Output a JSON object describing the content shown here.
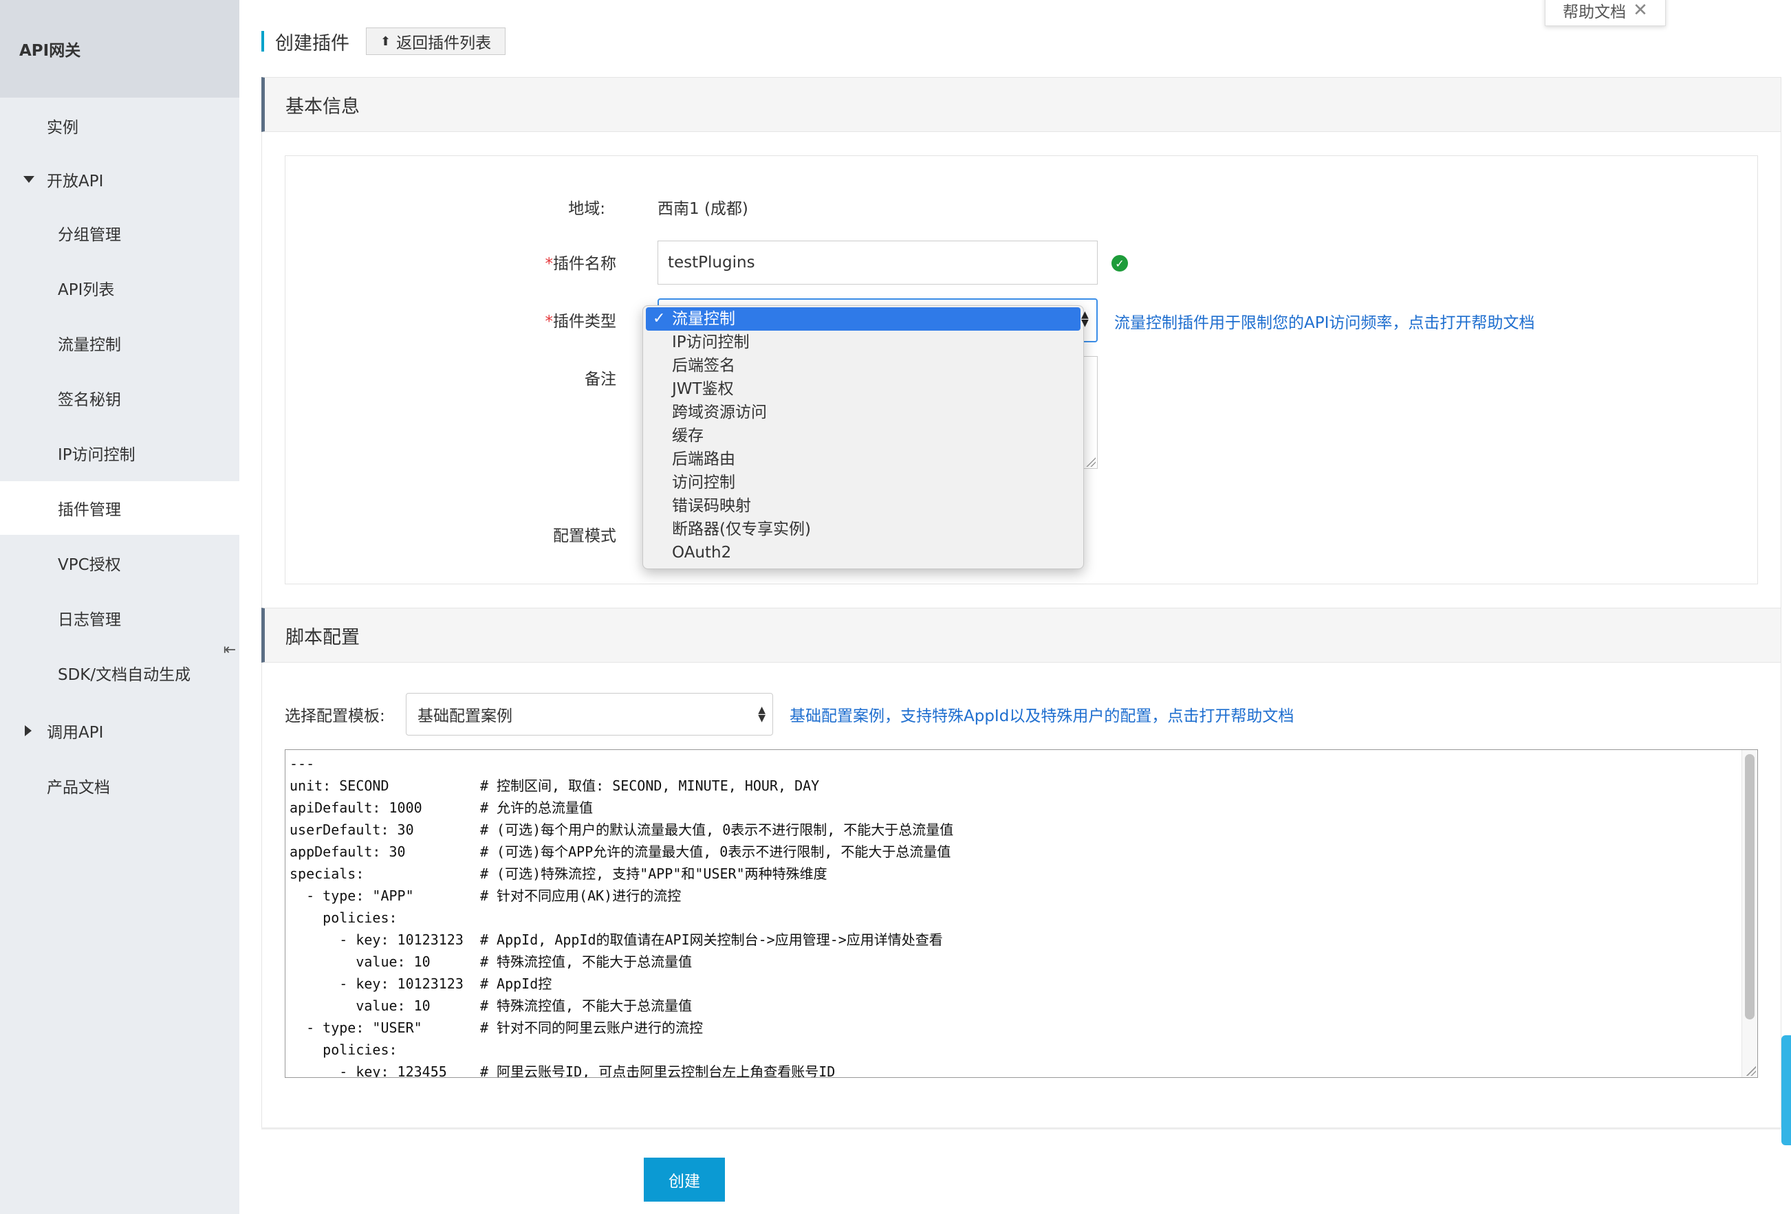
{
  "sidebar": {
    "title": "API网关",
    "items": [
      {
        "label": "实例"
      },
      {
        "label": "开放API"
      },
      {
        "label": "分组管理"
      },
      {
        "label": "API列表"
      },
      {
        "label": "流量控制"
      },
      {
        "label": "签名秘钥"
      },
      {
        "label": "IP访问控制"
      },
      {
        "label": "插件管理"
      },
      {
        "label": "VPC授权"
      },
      {
        "label": "日志管理"
      },
      {
        "label": "SDK/文档自动生成"
      },
      {
        "label": "调用API"
      },
      {
        "label": "产品文档"
      }
    ],
    "collapse_icon": "collapse-icon"
  },
  "header": {
    "title": "创建插件",
    "back_label": "返回插件列表",
    "help_label": "帮助文档"
  },
  "basic": {
    "section_title": "基本信息",
    "region_label": "地域:",
    "region_value": "西南1 (成都)",
    "name_label": "插件名称",
    "name_value": "testPlugins",
    "type_label": "插件类型",
    "type_hint": "流量控制插件用于限制您的API访问频率，点击打开帮助文档",
    "remark_label": "备注",
    "config_label": "配置模式",
    "required_mark": "*",
    "type_options": [
      "流量控制",
      "IP访问控制",
      "后端签名",
      "JWT鉴权",
      "跨域资源访问",
      "缓存",
      "后端路由",
      "访问控制",
      "错误码映射",
      "断路器(仅专享实例)",
      "OAuth2"
    ],
    "type_selected": "流量控制"
  },
  "script": {
    "section_title": "脚本配置",
    "template_label": "选择配置模板:",
    "template_value": "基础配置案例",
    "template_hint": "基础配置案例，支持特殊AppId以及特殊用户的配置，点击打开帮助文档",
    "code_lines": [
      "---",
      "unit: SECOND           # 控制区间, 取值: SECOND, MINUTE, HOUR, DAY",
      "apiDefault: 1000       # 允许的总流量值",
      "userDefault: 30        # (可选)每个用户的默认流量最大值, 0表示不进行限制, 不能大于总流量值",
      "appDefault: 30         # (可选)每个APP允许的流量最大值, 0表示不进行限制, 不能大于总流量值",
      "specials:              # (可选)特殊流控, 支持\"APP\"和\"USER\"两种特殊维度",
      "  - type: \"APP\"        # 针对不同应用(AK)进行的流控",
      "    policies:",
      "      - key: 10123123  # AppId, AppId的取值请在API网关控制台->应用管理->应用详情处查看",
      "        value: 10      # 特殊流控值, 不能大于总流量值",
      "      - key: 10123123  # AppId控",
      "        value: 10      # 特殊流控值, 不能大于总流量值",
      "  - type: \"USER\"       # 针对不同的阿里云账户进行的流控",
      "    policies:",
      "      - key: 123455    # 阿里云账号ID, 可点击阿里云控制台左上角查看账号ID"
    ]
  },
  "footer": {
    "create_label": "创建"
  }
}
